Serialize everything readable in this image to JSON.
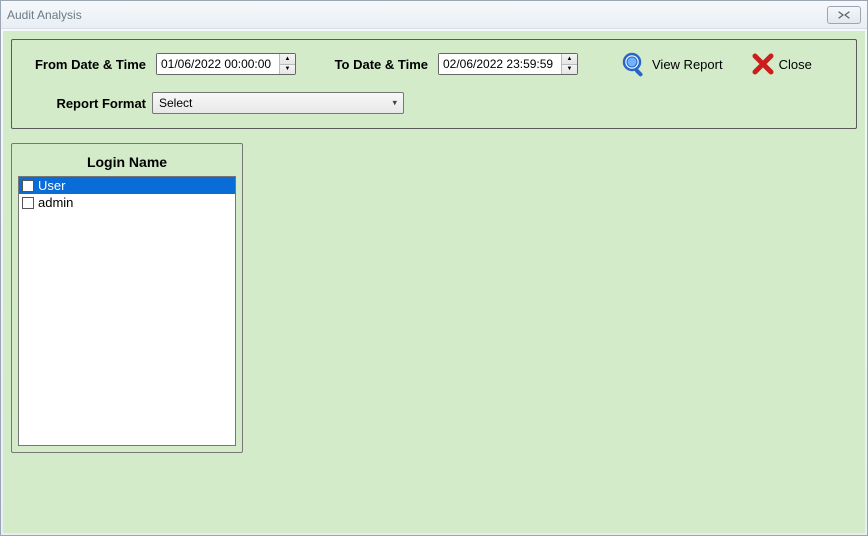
{
  "window": {
    "title": "Audit Analysis"
  },
  "labels": {
    "from": "From Date & Time",
    "to": "To Date & Time",
    "report_format": "Report Format",
    "login_name": "Login Name"
  },
  "inputs": {
    "from_value": "01/06/2022 00:00:00",
    "to_value": "02/06/2022 23:59:59",
    "report_format_value": "Select"
  },
  "buttons": {
    "view_report": "View Report",
    "close": "Close"
  },
  "login_list": {
    "items": [
      {
        "label": "User",
        "checked": false,
        "selected": true
      },
      {
        "label": "admin",
        "checked": false,
        "selected": false
      }
    ]
  }
}
